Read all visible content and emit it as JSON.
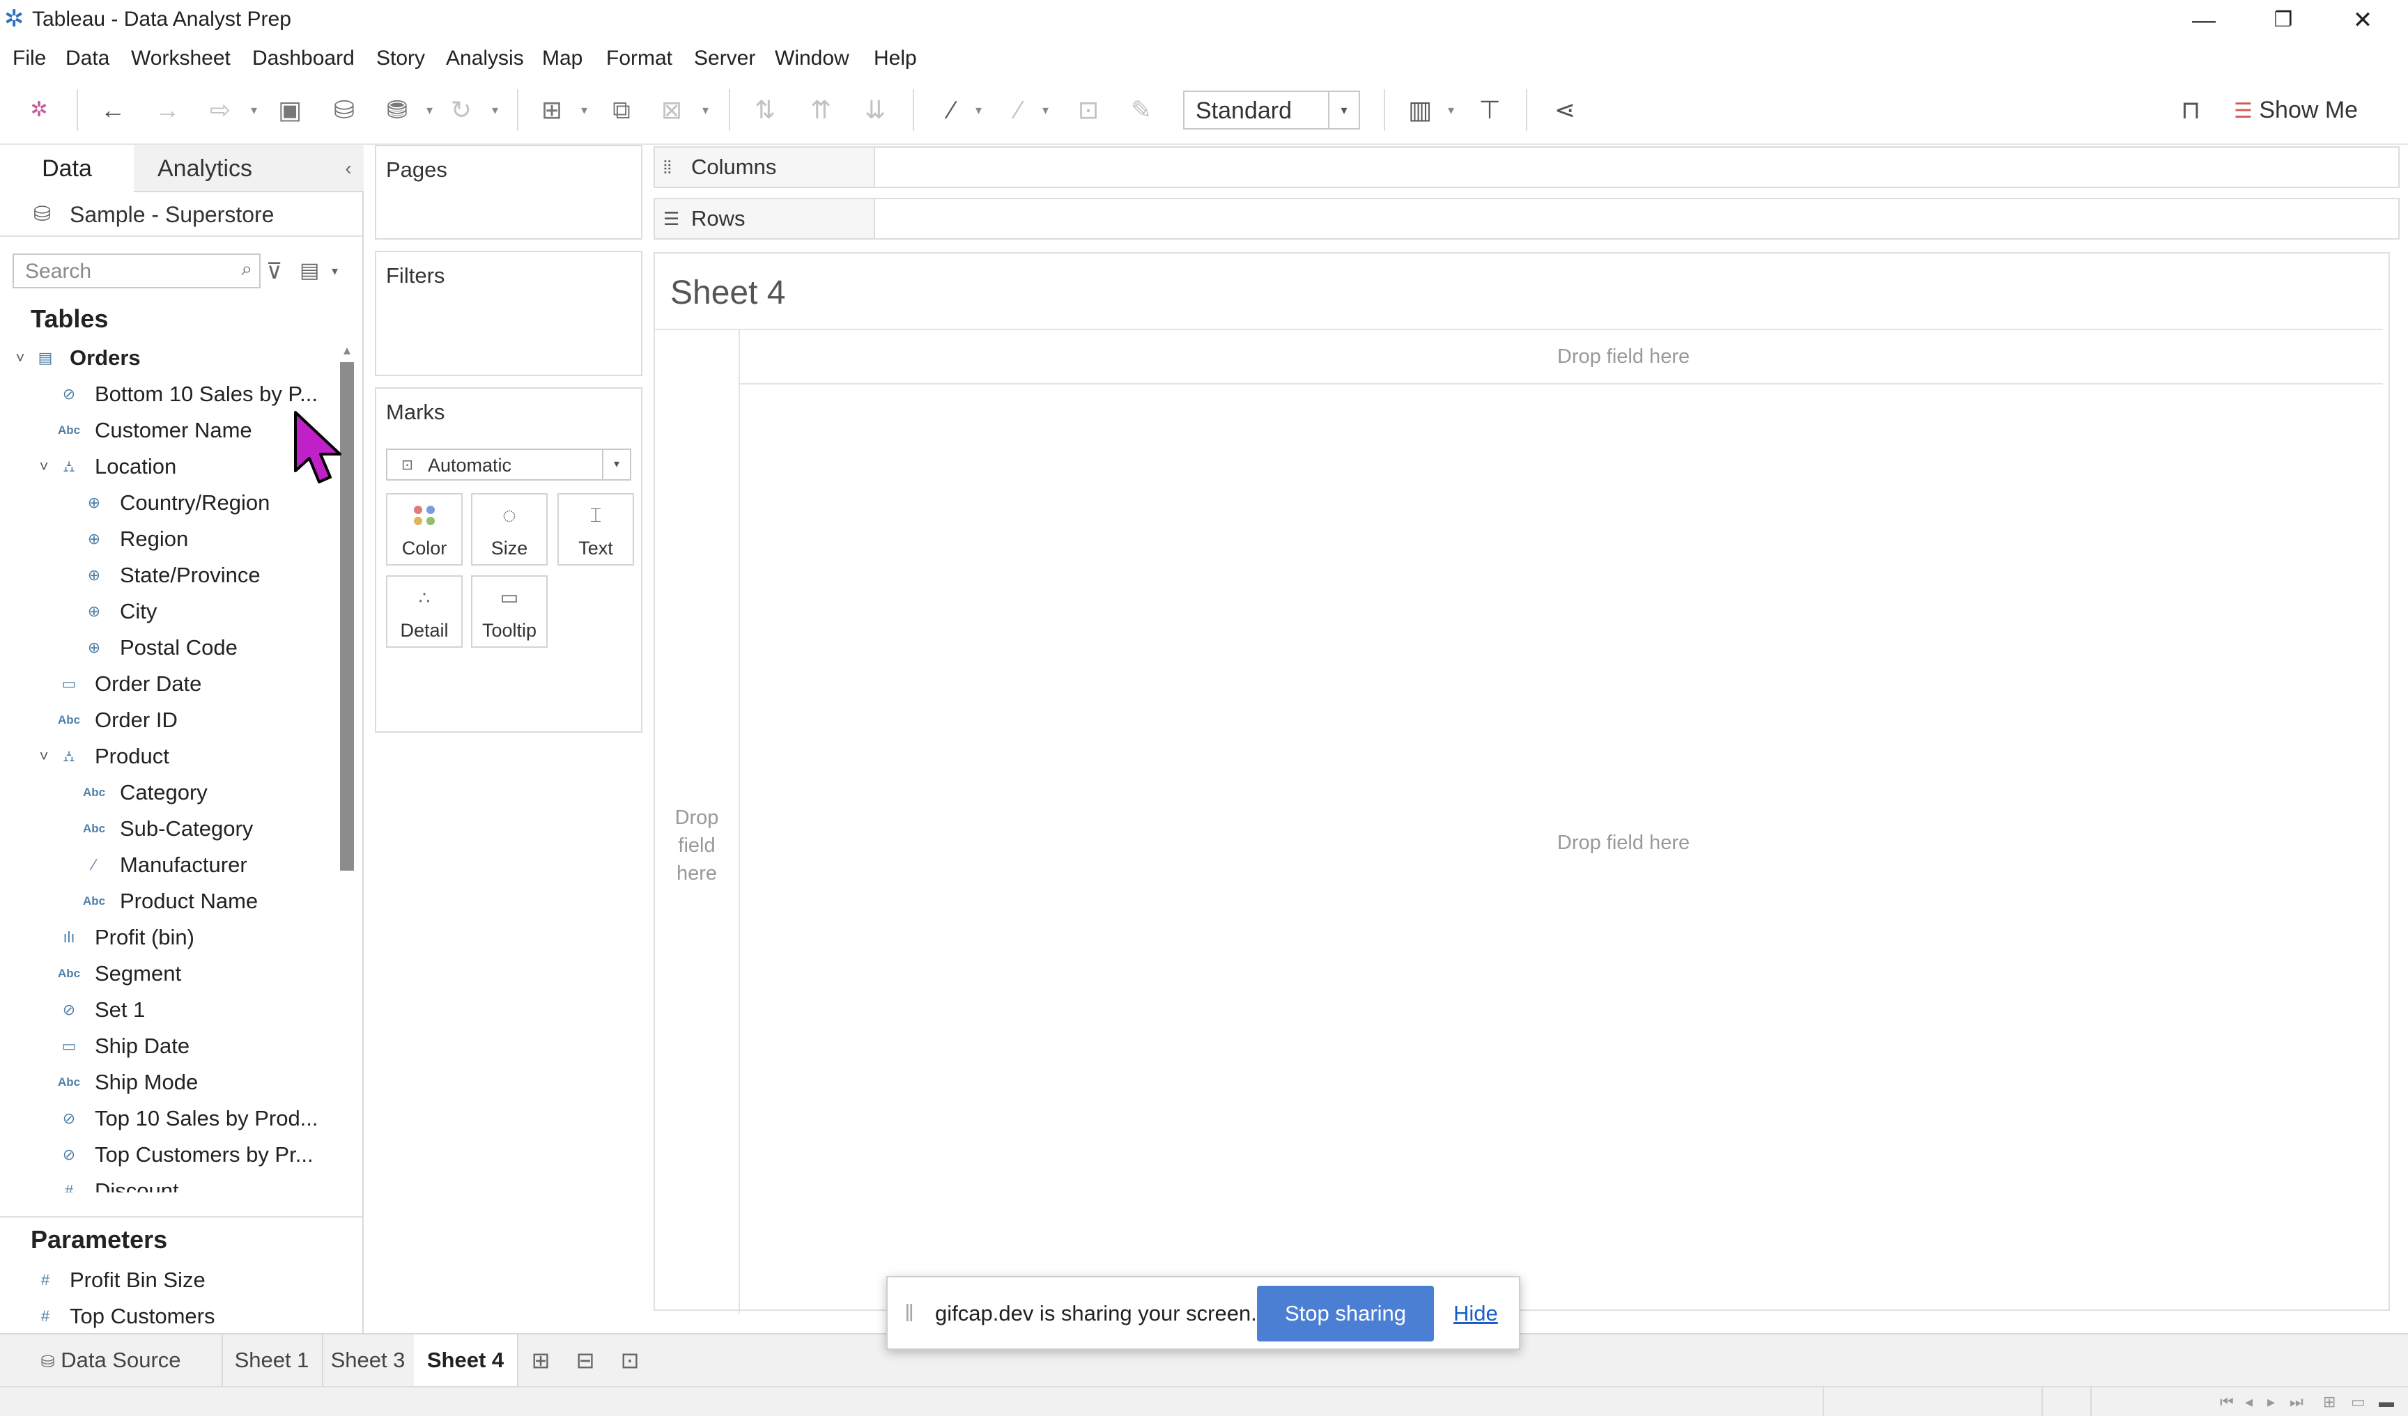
{
  "window": {
    "title": "Tableau - Data Analyst Prep",
    "controls": {
      "minimize": "—",
      "restore": "❐",
      "close": "✕"
    }
  },
  "menu": [
    "File",
    "Data",
    "Worksheet",
    "Dashboard",
    "Story",
    "Analysis",
    "Map",
    "Format",
    "Server",
    "Window",
    "Help"
  ],
  "toolbar": {
    "fit_select": "Standard",
    "show_me": "Show Me"
  },
  "data_pane": {
    "tab_data": "Data",
    "tab_analytics": "Analytics",
    "datasource": "Sample - Superstore",
    "search_placeholder": "Search",
    "tables_heading": "Tables",
    "fields": [
      {
        "label": "Orders",
        "icon": "table-icon",
        "glyph": "▤",
        "indent": 0,
        "chevron": "˅",
        "bold": true
      },
      {
        "label": "Bottom 10 Sales by P...",
        "icon": "set-icon",
        "glyph": "⊘",
        "indent": 1
      },
      {
        "label": "Customer Name",
        "icon": "string-icon",
        "glyph": "Abc",
        "indent": 1
      },
      {
        "label": "Location",
        "icon": "hierarchy-icon",
        "glyph": "⛼",
        "indent": 1,
        "chevron": "˅"
      },
      {
        "label": "Country/Region",
        "icon": "geo-icon",
        "glyph": "⊕",
        "indent": 2
      },
      {
        "label": "Region",
        "icon": "geo-icon",
        "glyph": "⊕",
        "indent": 2
      },
      {
        "label": "State/Province",
        "icon": "geo-icon",
        "glyph": "⊕",
        "indent": 2
      },
      {
        "label": "City",
        "icon": "geo-icon",
        "glyph": "⊕",
        "indent": 2
      },
      {
        "label": "Postal Code",
        "icon": "geo-icon",
        "glyph": "⊕",
        "indent": 2
      },
      {
        "label": "Order Date",
        "icon": "date-icon",
        "glyph": "▭",
        "indent": 1
      },
      {
        "label": "Order ID",
        "icon": "string-icon",
        "glyph": "Abc",
        "indent": 1
      },
      {
        "label": "Product",
        "icon": "hierarchy-icon",
        "glyph": "⛼",
        "indent": 1,
        "chevron": "˅"
      },
      {
        "label": "Category",
        "icon": "string-icon",
        "glyph": "Abc",
        "indent": 2
      },
      {
        "label": "Sub-Category",
        "icon": "string-icon",
        "glyph": "Abc",
        "indent": 2
      },
      {
        "label": "Manufacturer",
        "icon": "group-icon",
        "glyph": "⁄",
        "indent": 2
      },
      {
        "label": "Product Name",
        "icon": "string-icon",
        "glyph": "Abc",
        "indent": 2
      },
      {
        "label": "Profit (bin)",
        "icon": "bin-icon",
        "glyph": "ılı",
        "indent": 1
      },
      {
        "label": "Segment",
        "icon": "string-icon",
        "glyph": "Abc",
        "indent": 1
      },
      {
        "label": "Set 1",
        "icon": "set-icon",
        "glyph": "⊘",
        "indent": 1
      },
      {
        "label": "Ship Date",
        "icon": "date-icon",
        "glyph": "▭",
        "indent": 1
      },
      {
        "label": "Ship Mode",
        "icon": "string-icon",
        "glyph": "Abc",
        "indent": 1
      },
      {
        "label": "Top 10 Sales by Prod...",
        "icon": "set-icon",
        "glyph": "⊘",
        "indent": 1
      },
      {
        "label": "Top Customers by Pr...",
        "icon": "set-icon",
        "glyph": "⊘",
        "indent": 1
      },
      {
        "label": "Discount",
        "icon": "number-icon",
        "glyph": "#",
        "indent": 1
      }
    ],
    "parameters_heading": "Parameters",
    "parameters": [
      {
        "label": "Profit Bin Size",
        "glyph": "#"
      },
      {
        "label": "Top Customers",
        "glyph": "#"
      }
    ]
  },
  "cards": {
    "pages": "Pages",
    "filters": "Filters",
    "marks": "Marks",
    "mark_type": "Automatic",
    "mark_buttons": [
      "Color",
      "Size",
      "Text",
      "Detail",
      "Tooltip"
    ]
  },
  "shelves": {
    "columns": "Columns",
    "rows": "Rows"
  },
  "view": {
    "sheet_title": "Sheet 4",
    "drop_top": "Drop field here",
    "drop_center": "Drop field here",
    "drop_left": "Drop\nfield\nhere"
  },
  "sheet_tabs": {
    "data_source": "Data Source",
    "sheets": [
      "Sheet 1",
      "Sheet 3",
      "Sheet 4"
    ],
    "active": "Sheet 4"
  },
  "share_banner": {
    "text": "gifcap.dev is sharing your screen.",
    "stop": "Stop sharing",
    "hide": "Hide"
  },
  "colors": {
    "accent": "#4a7fd4",
    "field_icon": "#4d7fa8",
    "cursor": "#c020c8"
  }
}
